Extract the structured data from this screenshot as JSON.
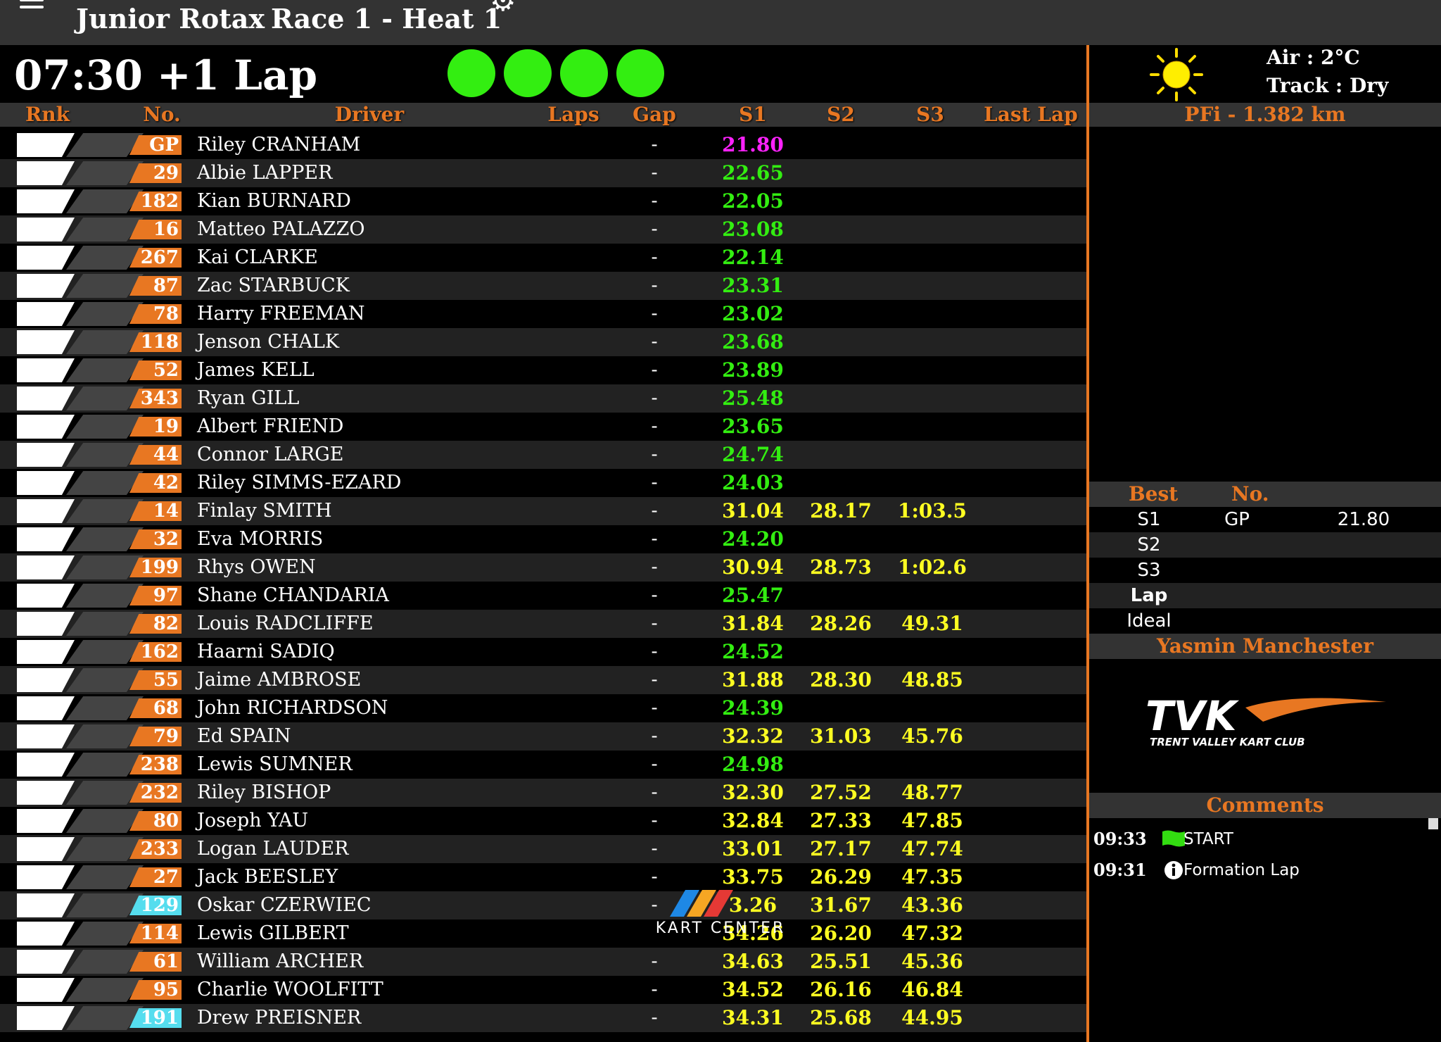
{
  "topbar": {
    "series": "Junior Rotax",
    "race": "Race 1 - Heat 1"
  },
  "session": {
    "clock": "07:30 +1 Lap"
  },
  "columns": {
    "rnk": "Rnk",
    "no": "No.",
    "driver": "Driver",
    "laps": "Laps",
    "gap": "Gap",
    "s1": "S1",
    "s2": "S2",
    "s3": "S3",
    "last": "Last Lap"
  },
  "colors": {
    "accent": "#e87722",
    "green": "#33ee11",
    "yellow": "#ffff22",
    "magenta": "#ff22ff",
    "cyan": "#55ddee"
  },
  "rows": [
    {
      "no": "GP",
      "driver": "Riley CRANHAM",
      "gap": "-",
      "s1": "21.80",
      "s1c": "magenta",
      "s2": "",
      "s3": "",
      "cyan": false
    },
    {
      "no": "29",
      "driver": "Albie LAPPER",
      "gap": "-",
      "s1": "22.65",
      "s1c": "green",
      "s2": "",
      "s3": "",
      "cyan": false
    },
    {
      "no": "182",
      "driver": "Kian BURNARD",
      "gap": "-",
      "s1": "22.05",
      "s1c": "green",
      "s2": "",
      "s3": "",
      "cyan": false
    },
    {
      "no": "16",
      "driver": "Matteo PALAZZO",
      "gap": "-",
      "s1": "23.08",
      "s1c": "green",
      "s2": "",
      "s3": "",
      "cyan": false
    },
    {
      "no": "267",
      "driver": "Kai CLARKE",
      "gap": "-",
      "s1": "22.14",
      "s1c": "green",
      "s2": "",
      "s3": "",
      "cyan": false
    },
    {
      "no": "87",
      "driver": "Zac STARBUCK",
      "gap": "-",
      "s1": "23.31",
      "s1c": "green",
      "s2": "",
      "s3": "",
      "cyan": false
    },
    {
      "no": "78",
      "driver": "Harry FREEMAN",
      "gap": "-",
      "s1": "23.02",
      "s1c": "green",
      "s2": "",
      "s3": "",
      "cyan": false
    },
    {
      "no": "118",
      "driver": "Jenson CHALK",
      "gap": "-",
      "s1": "23.68",
      "s1c": "green",
      "s2": "",
      "s3": "",
      "cyan": false
    },
    {
      "no": "52",
      "driver": "James KELL",
      "gap": "-",
      "s1": "23.89",
      "s1c": "green",
      "s2": "",
      "s3": "",
      "cyan": false
    },
    {
      "no": "343",
      "driver": "Ryan GILL",
      "gap": "-",
      "s1": "25.48",
      "s1c": "green",
      "s2": "",
      "s3": "",
      "cyan": false
    },
    {
      "no": "19",
      "driver": "Albert FRIEND",
      "gap": "-",
      "s1": "23.65",
      "s1c": "green",
      "s2": "",
      "s3": "",
      "cyan": false
    },
    {
      "no": "44",
      "driver": "Connor LARGE",
      "gap": "-",
      "s1": "24.74",
      "s1c": "green",
      "s2": "",
      "s3": "",
      "cyan": false
    },
    {
      "no": "42",
      "driver": "Riley SIMMS-EZARD",
      "gap": "-",
      "s1": "24.03",
      "s1c": "green",
      "s2": "",
      "s3": "",
      "cyan": false
    },
    {
      "no": "14",
      "driver": "Finlay SMITH",
      "gap": "-",
      "s1": "31.04",
      "s1c": "yellow",
      "s2": "28.17",
      "s3": "1:03.5",
      "cyan": false
    },
    {
      "no": "32",
      "driver": "Eva MORRIS",
      "gap": "-",
      "s1": "24.20",
      "s1c": "green",
      "s2": "",
      "s3": "",
      "cyan": false
    },
    {
      "no": "199",
      "driver": "Rhys OWEN",
      "gap": "-",
      "s1": "30.94",
      "s1c": "yellow",
      "s2": "28.73",
      "s3": "1:02.6",
      "cyan": false
    },
    {
      "no": "97",
      "driver": "Shane CHANDARIA",
      "gap": "-",
      "s1": "25.47",
      "s1c": "green",
      "s2": "",
      "s3": "",
      "cyan": false
    },
    {
      "no": "82",
      "driver": "Louis RADCLIFFE",
      "gap": "-",
      "s1": "31.84",
      "s1c": "yellow",
      "s2": "28.26",
      "s3": "49.31",
      "cyan": false
    },
    {
      "no": "162",
      "driver": "Haarni SADIQ",
      "gap": "-",
      "s1": "24.52",
      "s1c": "green",
      "s2": "",
      "s3": "",
      "cyan": false
    },
    {
      "no": "55",
      "driver": "Jaime AMBROSE",
      "gap": "-",
      "s1": "31.88",
      "s1c": "yellow",
      "s2": "28.30",
      "s3": "48.85",
      "cyan": false
    },
    {
      "no": "68",
      "driver": "John RICHARDSON",
      "gap": "-",
      "s1": "24.39",
      "s1c": "green",
      "s2": "",
      "s3": "",
      "cyan": false
    },
    {
      "no": "79",
      "driver": "Ed SPAIN",
      "gap": "-",
      "s1": "32.32",
      "s1c": "yellow",
      "s2": "31.03",
      "s3": "45.76",
      "cyan": false
    },
    {
      "no": "238",
      "driver": "Lewis SUMNER",
      "gap": "-",
      "s1": "24.98",
      "s1c": "green",
      "s2": "",
      "s3": "",
      "cyan": false
    },
    {
      "no": "232",
      "driver": "Riley BISHOP",
      "gap": "-",
      "s1": "32.30",
      "s1c": "yellow",
      "s2": "27.52",
      "s3": "48.77",
      "cyan": false
    },
    {
      "no": "80",
      "driver": "Joseph YAU",
      "gap": "-",
      "s1": "32.84",
      "s1c": "yellow",
      "s2": "27.33",
      "s3": "47.85",
      "cyan": false
    },
    {
      "no": "233",
      "driver": "Logan LAUDER",
      "gap": "-",
      "s1": "33.01",
      "s1c": "yellow",
      "s2": "27.17",
      "s3": "47.74",
      "cyan": false
    },
    {
      "no": "27",
      "driver": "Jack BEESLEY",
      "gap": "-",
      "s1": "33.75",
      "s1c": "yellow",
      "s2": "26.29",
      "s3": "47.35",
      "cyan": false
    },
    {
      "no": "129",
      "driver": "Oskar CZERWIEC",
      "gap": "-",
      "s1": "3.26",
      "s1c": "yellow",
      "s2": "31.67",
      "s3": "43.36",
      "cyan": true
    },
    {
      "no": "114",
      "driver": "Lewis GILBERT",
      "gap": "",
      "s1": "34.26",
      "s1c": "yellow",
      "s2": "26.20",
      "s3": "47.32",
      "cyan": false
    },
    {
      "no": "61",
      "driver": "William ARCHER",
      "gap": "-",
      "s1": "34.63",
      "s1c": "yellow",
      "s2": "25.51",
      "s3": "45.36",
      "cyan": false
    },
    {
      "no": "95",
      "driver": "Charlie WOOLFITT",
      "gap": "-",
      "s1": "34.52",
      "s1c": "yellow",
      "s2": "26.16",
      "s3": "46.84",
      "cyan": false
    },
    {
      "no": "191",
      "driver": "Drew PREISNER",
      "gap": "-",
      "s1": "34.31",
      "s1c": "yellow",
      "s2": "25.68",
      "s3": "44.95",
      "cyan": true
    }
  ],
  "weather": {
    "icon": "sun-icon",
    "air": "Air : 2°C",
    "track": "Track : Dry"
  },
  "circuit": "PFi - 1.382 km",
  "best": {
    "headers": {
      "best": "Best",
      "no": "No."
    },
    "rows": [
      {
        "label": "S1",
        "no": "GP",
        "value": "21.80"
      },
      {
        "label": "S2",
        "no": "",
        "value": ""
      },
      {
        "label": "S3",
        "no": "",
        "value": ""
      },
      {
        "label": "Lap",
        "no": "",
        "value": ""
      },
      {
        "label": "Ideal",
        "no": "",
        "value": ""
      }
    ]
  },
  "person": "Yasmin Manchester",
  "logo": {
    "text": "TVK",
    "subtitle": "TRENT VALLEY KART CLUB"
  },
  "comments": {
    "title": "Comments",
    "items": [
      {
        "time": "09:33",
        "icon": "green-flag-icon",
        "text": "START"
      },
      {
        "time": "09:31",
        "icon": "info-icon",
        "text": "Formation Lap"
      }
    ]
  },
  "watermark": "KART CENTER"
}
